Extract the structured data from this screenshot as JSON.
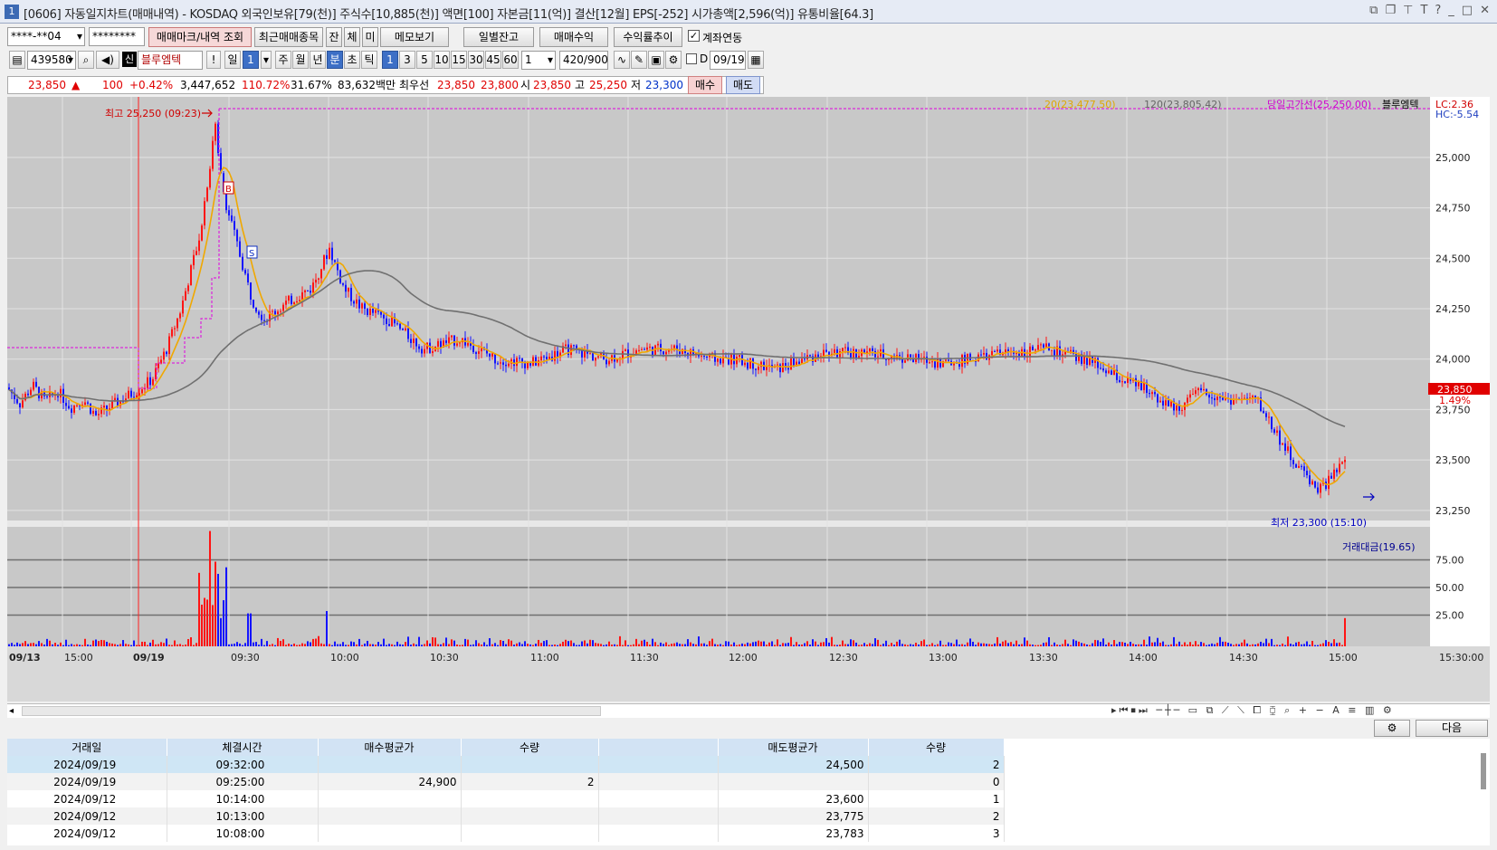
{
  "window": {
    "num": "1",
    "title": "[0606] 자동일지차트(매매내역) - KOSDAQ 외국인보유[79(천)] 주식수[10,885(천)] 액면[100] 자본금[11(억)] 결산[12월] EPS[-252] 시가총액[2,596(억)] 유통비율[64.3]"
  },
  "toolbar1": {
    "account": "****-**04",
    "password": "********",
    "b1": "매매마크/내역 조회",
    "b2": "최근매매종목",
    "b3": "잔",
    "b4": "체",
    "b5": "미",
    "b6": "메모보기",
    "b7": "일별잔고",
    "b8": "매매수익",
    "b9": "수익률추이",
    "check": "계좌연동"
  },
  "toolbar2": {
    "code": "439580",
    "badge": "신",
    "name": "블루엠텍",
    "excl": "!",
    "periods": [
      "일",
      "1",
      "주",
      "월",
      "년",
      "분",
      "초",
      "틱"
    ],
    "mins": [
      "1",
      "3",
      "5",
      "10",
      "15",
      "30",
      "45",
      "60"
    ],
    "n": "1",
    "count": "420",
    "total": "/900",
    "d": "D",
    "date": "09/19"
  },
  "quote": {
    "price": "23,850",
    "arrow": "▲",
    "change": "100",
    "pct": "+0.42%",
    "volume": "3,447,652",
    "r1": "110.72%",
    "r2": "31.67%",
    "amount": "83,632백만",
    "best": "최우선",
    "ask": "23,850",
    "bid": "23,800",
    "open_l": "시",
    "open": "23,850",
    "high_l": "고",
    "high": "25,250",
    "low_l": "저",
    "low": "23,300",
    "buy": "매수",
    "sell": "매도"
  },
  "legend": {
    "ma20": "20(23,477.50)",
    "ma120": "120(23,805.42)",
    "hline": "당일고가선(25,250.00)",
    "stock": "블루엠텍",
    "lc": "LC:2.36",
    "hc": "HC:-5.54",
    "vol": "거래대금(19.65)"
  },
  "annotations": {
    "high": "최고 25,250 (09:23)",
    "low": "최저 23,300 (15:10)",
    "cur_price": "23,850",
    "cur_pct": "1.49%",
    "b_mark": "B",
    "s_mark": "S"
  },
  "chart_data": {
    "type": "candlestick",
    "price_ticks": [
      "25,000",
      "24,750",
      "24,500",
      "24,250",
      "24,000",
      "23,750",
      "23,500",
      "23,250"
    ],
    "price_range": [
      23200,
      25300
    ],
    "vol_ticks": [
      "75.00",
      "50.00",
      "25.00"
    ],
    "time_labels": [
      "09/13",
      "15:00",
      "09/19",
      "09:30",
      "10:00",
      "10:30",
      "11:00",
      "11:30",
      "12:00",
      "12:30",
      "13:00",
      "13:30",
      "14:00",
      "14:30",
      "15:00",
      "15:30:00"
    ],
    "prev_close": 23750,
    "high": 25250,
    "low": 23300,
    "close": 23850,
    "ma20_last": 23477.5,
    "ma120_last": 23805.42,
    "close_path": [
      [
        "09/13",
        23860
      ],
      [
        "09/13",
        23780
      ],
      [
        "09/13",
        23870
      ],
      [
        "09/13",
        23790
      ],
      [
        "09/13",
        23840
      ],
      [
        "09/13",
        23760
      ],
      [
        "09/13",
        23800
      ],
      [
        "09/13",
        23720
      ],
      [
        "09:00",
        23850
      ],
      [
        "09:05",
        23900
      ],
      [
        "09:10",
        24050
      ],
      [
        "09:15",
        24250
      ],
      [
        "09:20",
        24600
      ],
      [
        "09:23",
        25150
      ],
      [
        "09:25",
        24800
      ],
      [
        "09:30",
        24600
      ],
      [
        "09:35",
        24300
      ],
      [
        "09:40",
        24200
      ],
      [
        "09:45",
        24250
      ],
      [
        "09:50",
        24300
      ],
      [
        "09:55",
        24350
      ],
      [
        "10:00",
        24550
      ],
      [
        "10:05",
        24350
      ],
      [
        "10:10",
        24250
      ],
      [
        "10:20",
        24200
      ],
      [
        "10:30",
        24050
      ],
      [
        "10:40",
        24100
      ],
      [
        "10:50",
        24000
      ],
      [
        "11:00",
        23980
      ],
      [
        "11:10",
        24050
      ],
      [
        "11:20",
        24000
      ],
      [
        "11:30",
        24050
      ],
      [
        "11:40",
        24050
      ],
      [
        "11:50",
        24000
      ],
      [
        "12:00",
        24000
      ],
      [
        "12:15",
        23950
      ],
      [
        "12:30",
        24030
      ],
      [
        "12:45",
        24030
      ],
      [
        "13:00",
        24000
      ],
      [
        "13:15",
        23980
      ],
      [
        "13:30",
        24030
      ],
      [
        "13:45",
        24050
      ],
      [
        "14:00",
        23980
      ],
      [
        "14:10",
        23900
      ],
      [
        "14:20",
        23850
      ],
      [
        "14:30",
        23750
      ],
      [
        "14:40",
        23840
      ],
      [
        "14:50",
        23800
      ],
      [
        "15:00",
        23800
      ],
      [
        "15:05",
        23500
      ],
      [
        "15:10",
        23350
      ],
      [
        "15:15",
        23500
      ]
    ],
    "grid": true
  },
  "table": {
    "headers": [
      "거래일",
      "체결시간",
      "매수평균가",
      "수량",
      "",
      "매도평균가",
      "수량"
    ],
    "rows": [
      [
        "2024/09/19",
        "09:32:00",
        "",
        "",
        "",
        "24,500",
        "2"
      ],
      [
        "2024/09/19",
        "09:25:00",
        "24,900",
        "2",
        "",
        "",
        "0"
      ],
      [
        "2024/09/12",
        "10:14:00",
        "",
        "",
        "",
        "23,600",
        "1"
      ],
      [
        "2024/09/12",
        "10:13:00",
        "",
        "",
        "",
        "23,775",
        "2"
      ],
      [
        "2024/09/12",
        "10:08:00",
        "",
        "",
        "",
        "23,783",
        "3"
      ]
    ],
    "next": "다음"
  }
}
